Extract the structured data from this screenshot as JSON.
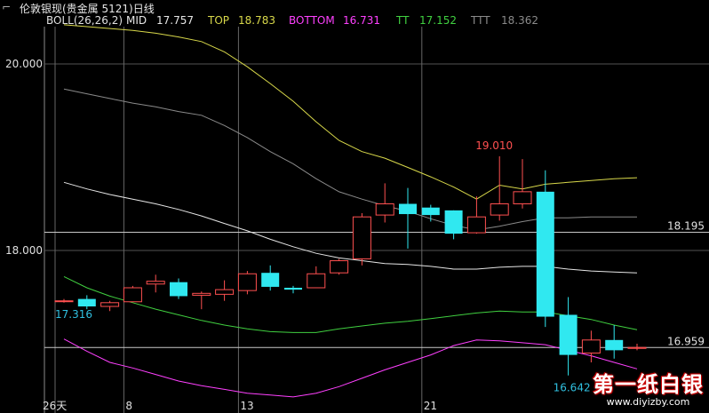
{
  "window_title": "伦敦银现(贵金属 5121)日线",
  "indicator": {
    "name": "BOLL(26,26,2)",
    "items": [
      {
        "label": "MID",
        "value": "17.757",
        "color": "#e6e6e6"
      },
      {
        "label": "TOP",
        "value": "18.783",
        "color": "#d8d84a"
      },
      {
        "label": "BOTTOM",
        "value": "16.731",
        "color": "#ff40ff"
      },
      {
        "label": "TT",
        "value": "17.152",
        "color": "#40d040"
      },
      {
        "label": "TTT",
        "value": "18.362",
        "color": "#8a8a8a"
      }
    ]
  },
  "logo": {
    "text": "第一纸白银",
    "url": "www.diyizby.com"
  },
  "chart_data": {
    "type": "candlestick",
    "ylim": [
      16.4,
      20.6
    ],
    "y_ticks": [
      "20.000",
      "18.000"
    ],
    "x_tick_labels": [
      "26天",
      "8",
      "13",
      "21"
    ],
    "price_lines": [
      "18.195",
      "16.959"
    ],
    "annotations": [
      "19.010",
      "17.316",
      "16.642"
    ],
    "colors": {
      "up": "#ff5050",
      "down": "#30e8f0",
      "grid": "#8a8a8a",
      "label": "#e0e0e0",
      "annotation_high": "#ff5050",
      "annotation_low": "#30c0e0"
    },
    "candles": [
      {
        "o": 17.46,
        "h": 17.48,
        "l": 17.44,
        "c": 17.46
      },
      {
        "o": 17.48,
        "h": 17.52,
        "l": 17.37,
        "c": 17.4
      },
      {
        "o": 17.4,
        "h": 17.46,
        "l": 17.35,
        "c": 17.44
      },
      {
        "o": 17.45,
        "h": 17.62,
        "l": 17.45,
        "c": 17.6
      },
      {
        "o": 17.64,
        "h": 17.74,
        "l": 17.55,
        "c": 17.67
      },
      {
        "o": 17.66,
        "h": 17.7,
        "l": 17.48,
        "c": 17.51
      },
      {
        "o": 17.52,
        "h": 17.56,
        "l": 17.37,
        "c": 17.54
      },
      {
        "o": 17.53,
        "h": 17.68,
        "l": 17.46,
        "c": 17.58
      },
      {
        "o": 17.57,
        "h": 17.78,
        "l": 17.53,
        "c": 17.75
      },
      {
        "o": 17.76,
        "h": 17.84,
        "l": 17.57,
        "c": 17.61
      },
      {
        "o": 17.6,
        "h": 17.62,
        "l": 17.54,
        "c": 17.58
      },
      {
        "o": 17.6,
        "h": 17.83,
        "l": 17.6,
        "c": 17.75
      },
      {
        "o": 17.76,
        "h": 17.91,
        "l": 17.74,
        "c": 17.89
      },
      {
        "o": 17.91,
        "h": 18.4,
        "l": 17.84,
        "c": 18.36
      },
      {
        "o": 18.38,
        "h": 18.72,
        "l": 18.3,
        "c": 18.5
      },
      {
        "o": 18.5,
        "h": 18.67,
        "l": 18.02,
        "c": 18.39
      },
      {
        "o": 18.46,
        "h": 18.49,
        "l": 18.31,
        "c": 18.38
      },
      {
        "o": 18.43,
        "h": 18.43,
        "l": 18.12,
        "c": 18.18
      },
      {
        "o": 18.19,
        "h": 18.58,
        "l": 18.18,
        "c": 18.36
      },
      {
        "o": 18.38,
        "h": 19.01,
        "l": 18.32,
        "c": 18.5
      },
      {
        "o": 18.5,
        "h": 18.98,
        "l": 18.45,
        "c": 18.63
      },
      {
        "o": 18.63,
        "h": 18.86,
        "l": 17.18,
        "c": 17.29
      },
      {
        "o": 17.31,
        "h": 17.5,
        "l": 16.66,
        "c": 16.88
      },
      {
        "o": 16.9,
        "h": 17.14,
        "l": 16.8,
        "c": 17.04
      },
      {
        "o": 17.04,
        "h": 17.2,
        "l": 16.84,
        "c": 16.93
      },
      {
        "o": 16.95,
        "h": 17.0,
        "l": 16.93,
        "c": 16.96
      }
    ],
    "series": [
      {
        "key": "TOP",
        "color": "#d8d84a",
        "values": [
          20.42,
          20.4,
          20.38,
          20.36,
          20.33,
          20.29,
          20.24,
          20.13,
          19.97,
          19.79,
          19.6,
          19.38,
          19.18,
          19.06,
          18.99,
          18.89,
          18.79,
          18.68,
          18.55,
          18.7,
          18.66,
          18.71,
          18.73,
          18.75,
          18.77,
          18.78
        ]
      },
      {
        "key": "TTT",
        "color": "#8a8a8a",
        "values": [
          19.73,
          19.68,
          19.63,
          19.58,
          19.54,
          19.49,
          19.45,
          19.34,
          19.21,
          19.06,
          18.93,
          18.77,
          18.63,
          18.55,
          18.48,
          18.42,
          18.34,
          18.27,
          18.22,
          18.26,
          18.31,
          18.35,
          18.35,
          18.36,
          18.36,
          18.36
        ]
      },
      {
        "key": "MID",
        "color": "#e6e6e6",
        "values": [
          18.73,
          18.66,
          18.6,
          18.55,
          18.5,
          18.44,
          18.37,
          18.29,
          18.21,
          18.12,
          18.04,
          17.97,
          17.92,
          17.89,
          17.86,
          17.85,
          17.83,
          17.8,
          17.8,
          17.82,
          17.83,
          17.83,
          17.8,
          17.78,
          17.77,
          17.76
        ]
      },
      {
        "key": "TT",
        "color": "#40d040",
        "values": [
          17.72,
          17.6,
          17.51,
          17.44,
          17.37,
          17.31,
          17.25,
          17.2,
          17.16,
          17.13,
          17.12,
          17.12,
          17.16,
          17.19,
          17.22,
          17.24,
          17.27,
          17.3,
          17.33,
          17.35,
          17.34,
          17.34,
          17.3,
          17.26,
          17.2,
          17.15
        ]
      },
      {
        "key": "BOTTOM",
        "color": "#ff40ff",
        "values": [
          17.05,
          16.92,
          16.8,
          16.74,
          16.67,
          16.6,
          16.55,
          16.51,
          16.47,
          16.45,
          16.43,
          16.47,
          16.54,
          16.63,
          16.72,
          16.8,
          16.88,
          16.98,
          17.04,
          17.03,
          17.01,
          16.99,
          16.93,
          16.87,
          16.8,
          16.73
        ]
      }
    ]
  }
}
